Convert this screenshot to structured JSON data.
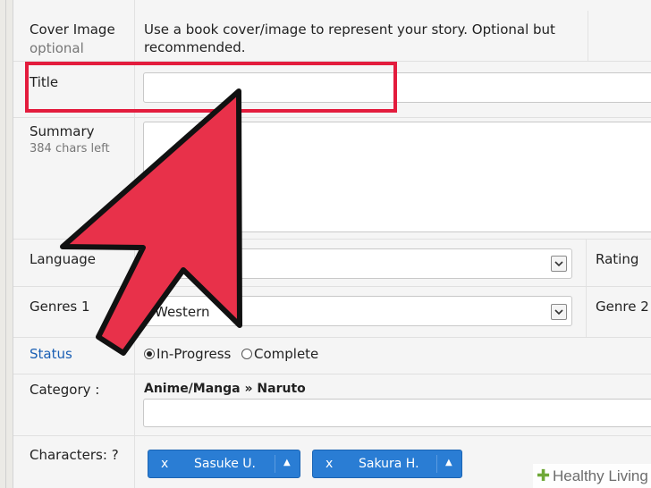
{
  "form": {
    "cover": {
      "label": "Cover Image",
      "sublabel": "optional",
      "hint_line1": "Use a book cover/image to represent your story. Optional but",
      "hint_line2": "recommended."
    },
    "title": {
      "label": "Title",
      "value": ""
    },
    "summary": {
      "label": "Summary",
      "chars_left": "384 chars left",
      "value": ""
    },
    "language": {
      "label": "Language",
      "value": ""
    },
    "rating": {
      "label": "Rating"
    },
    "genres1": {
      "label": "Genres 1",
      "value": "Western"
    },
    "genre2": {
      "label": "Genre 2"
    },
    "status": {
      "label": "Status",
      "options": [
        "In-Progress",
        "Complete"
      ],
      "selected": "In-Progress"
    },
    "category": {
      "label": "Category :",
      "value": "Anime/Manga » Naruto"
    },
    "characters": {
      "label": "Characters: ?",
      "chips": [
        {
          "remove": "x",
          "name": "Sasuke U."
        },
        {
          "remove": "x",
          "name": "Sakura H."
        }
      ]
    }
  },
  "watermark": {
    "brand": "Healthy Living"
  },
  "colors": {
    "highlight": "#e31c3d",
    "arrow": "#e8314a",
    "chip": "#2a7dd4",
    "status_label": "#1a5fb4"
  }
}
